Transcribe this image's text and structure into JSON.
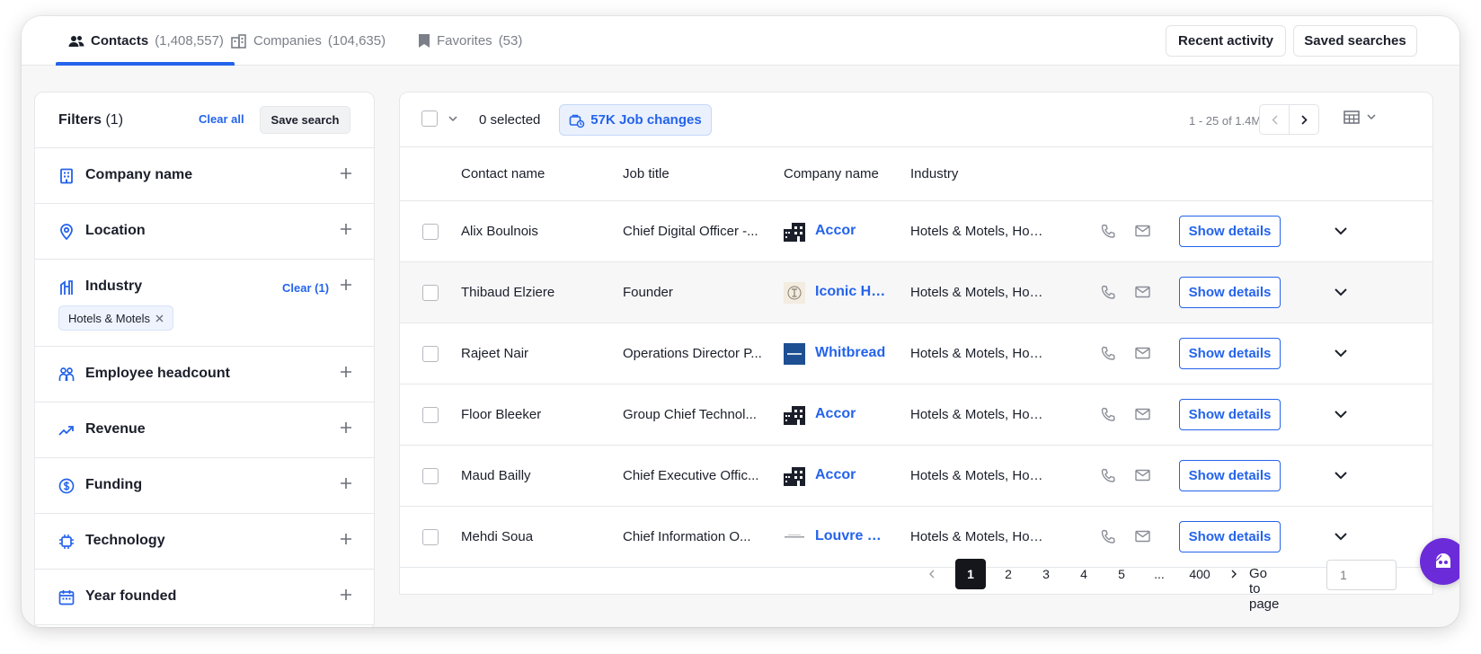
{
  "tabs": [
    {
      "label": "Contacts",
      "count": "(1,408,557)"
    },
    {
      "label": "Companies",
      "count": "(104,635)"
    },
    {
      "label": "Favorites",
      "count": "(53)"
    }
  ],
  "top_buttons": {
    "recent": "Recent activity",
    "saved": "Saved searches"
  },
  "filters": {
    "title": "Filters",
    "count": "(1)",
    "clear_all": "Clear all",
    "save_search": "Save search",
    "items": [
      {
        "label": "Company name",
        "icon": "building-icon"
      },
      {
        "label": "Location",
        "icon": "location-pin-icon"
      },
      {
        "label": "Industry",
        "icon": "industry-icon",
        "clear": "Clear (1)",
        "chip": "Hotels & Motels"
      },
      {
        "label": "Employee headcount",
        "icon": "people-icon"
      },
      {
        "label": "Revenue",
        "icon": "trend-up-icon"
      },
      {
        "label": "Funding",
        "icon": "dollar-icon"
      },
      {
        "label": "Technology",
        "icon": "chip-icon"
      },
      {
        "label": "Year founded",
        "icon": "calendar-icon"
      }
    ]
  },
  "toolbar": {
    "selected": "0 selected",
    "job_changes": "57K Job changes",
    "range": "1 - 25 of 1.4M"
  },
  "table": {
    "headers": [
      "Contact name",
      "Job title",
      "Company name",
      "Industry"
    ],
    "show_details_label": "Show details",
    "rows": [
      {
        "name": "Alix Boulnois",
        "title": "Chief Digital Officer -...",
        "company": "Accor",
        "industry": "Hotels & Motels, Hos..."
      },
      {
        "name": "Thibaud Elziere",
        "title": "Founder",
        "company": "Iconic Ho...",
        "industry": "Hotels & Motels, Hos..."
      },
      {
        "name": "Rajeet Nair",
        "title": "Operations Director P...",
        "company": "Whitbread",
        "industry": "Hotels & Motels, Hos..."
      },
      {
        "name": "Floor Bleeker",
        "title": "Group Chief Technol...",
        "company": "Accor",
        "industry": "Hotels & Motels, Hos..."
      },
      {
        "name": "Maud Bailly",
        "title": "Chief Executive Offic...",
        "company": "Accor",
        "industry": "Hotels & Motels, Hos..."
      },
      {
        "name": "Mehdi Soua",
        "title": "Chief Information O...",
        "company": "Louvre H...",
        "industry": "Hotels & Motels, Hos..."
      }
    ]
  },
  "pagination": {
    "pages": [
      "1",
      "2",
      "3",
      "4",
      "5",
      "...",
      "400"
    ],
    "current": "1",
    "goto_label": "Go to page",
    "goto_value": "1"
  },
  "colors": {
    "accent": "#2463eb",
    "fab": "#6c2bd9"
  }
}
